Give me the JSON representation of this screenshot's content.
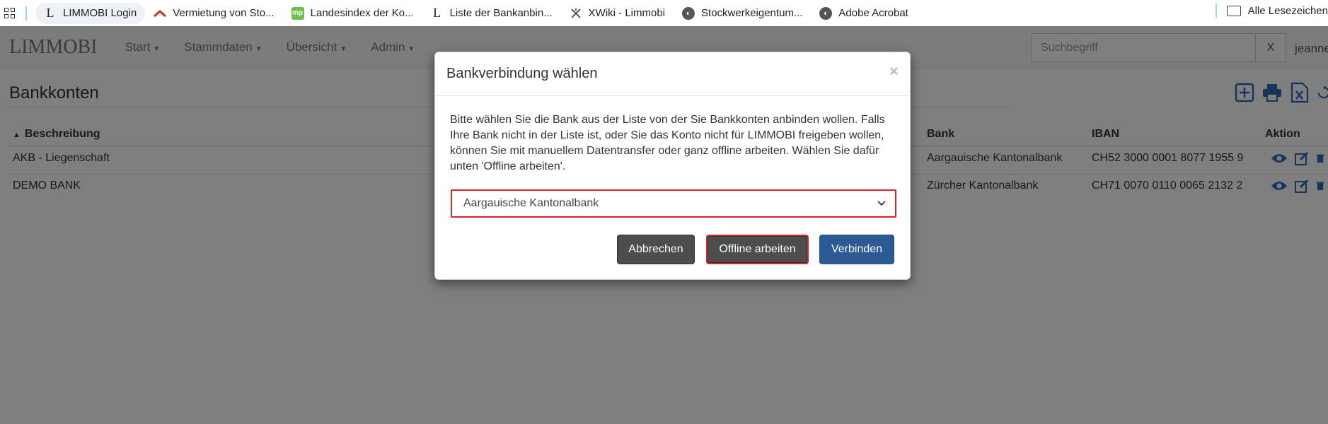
{
  "bookmarks": [
    {
      "label": "LIMMOBI Login",
      "icon": "limmobi-l-icon"
    },
    {
      "label": "Vermietung von Sto...",
      "icon": "chevron-logo-icon"
    },
    {
      "label": "Landesindex der Ko...",
      "icon": "mp-logo-icon"
    },
    {
      "label": "Liste der Bankanbin...",
      "icon": "limmobi-l-icon"
    },
    {
      "label": "XWiki - Limmobi",
      "icon": "xwiki-icon"
    },
    {
      "label": "Stockwerkeigentum...",
      "icon": "globe-icon"
    },
    {
      "label": "Adobe Acrobat",
      "icon": "globe-icon"
    }
  ],
  "bookmarks_other": "Alle Lesezeichen",
  "navbar": {
    "brand": "LIMMOBI",
    "items": [
      "Start",
      "Stammdaten",
      "Übersicht",
      "Admin"
    ],
    "search_placeholder": "Suchbegriff",
    "search_clear": "X",
    "user": "jeanne"
  },
  "page": {
    "title": "Bankkonten"
  },
  "table": {
    "headers": {
      "beschreibung": "Beschreibung",
      "bank": "Bank",
      "iban": "IBAN",
      "aktion": "Aktion"
    },
    "rows": [
      {
        "beschreibung": "AKB - Liegenschaft",
        "bank": "Aargauische Kantonalbank",
        "iban": "CH52 3000 0001 8077 1955 9"
      },
      {
        "beschreibung": "DEMO BANK",
        "bank": "Zürcher Kantonalbank",
        "iban": "CH71 0070 0110 0065 2132 2"
      }
    ]
  },
  "modal": {
    "title": "Bankverbindung wählen",
    "close": "×",
    "text": "Bitte wählen Sie die Bank aus der Liste von der Sie Bankkonten anbinden wollen. Falls Ihre Bank nicht in der Liste ist, oder Sie das Konto nicht für LIMMOBI freigeben wollen, können Sie mit manuellem Datentransfer oder ganz offline arbeiten. Wählen Sie dafür unten 'Offline arbeiten'.",
    "selected_bank": "Aargauische Kantonalbank",
    "buttons": {
      "cancel": "Abbrechen",
      "offline": "Offline arbeiten",
      "connect": "Verbinden"
    }
  },
  "colors": {
    "accent": "#2a6db5",
    "highlight": "#d9252b",
    "primary_button": "#2c5a94",
    "default_button": "#4d4d4d"
  }
}
